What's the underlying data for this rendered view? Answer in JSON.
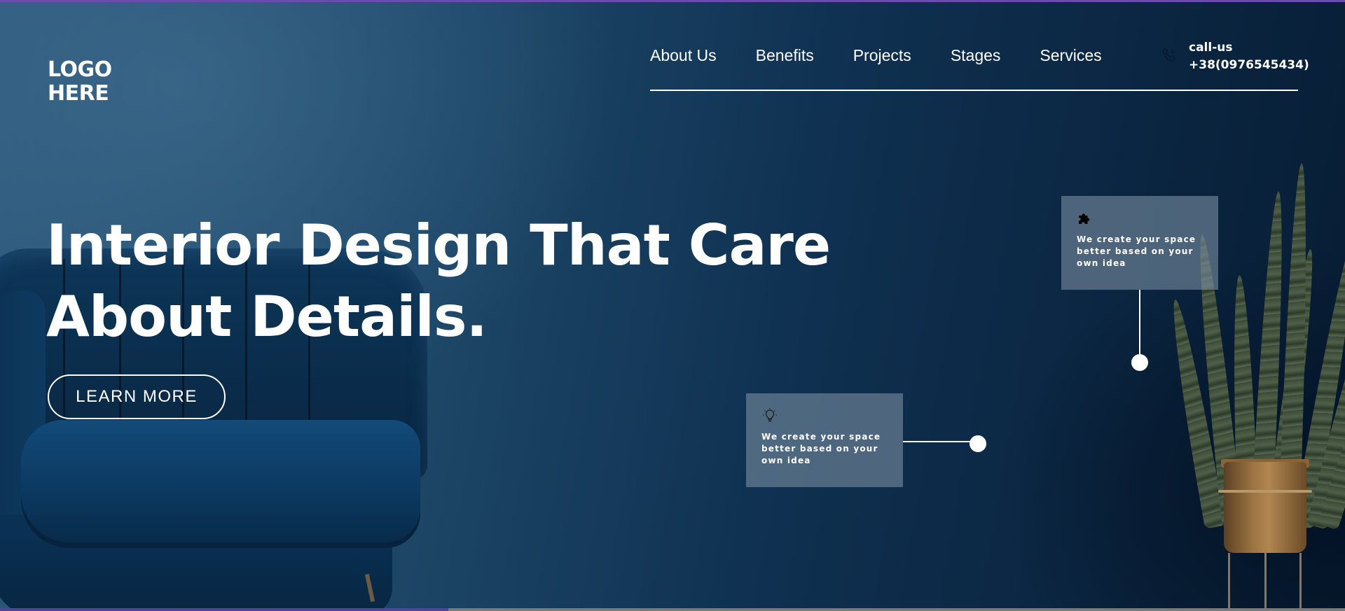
{
  "logo": {
    "line1": "LOGO",
    "line2": "HERE"
  },
  "nav": {
    "items": [
      {
        "label": "About Us"
      },
      {
        "label": "Benefits"
      },
      {
        "label": "Projects"
      },
      {
        "label": "Stages"
      },
      {
        "label": "Services"
      }
    ]
  },
  "contact": {
    "label": "call-us",
    "phone": "+38(0976545434)",
    "icon": "phone-icon"
  },
  "hero": {
    "title_line1": "Interior Design That Care",
    "title_line2": "About Details.",
    "cta_label": "LEARN MORE"
  },
  "cards": [
    {
      "icon": "puzzle-icon",
      "text": "We create your space better based on your own idea"
    },
    {
      "icon": "lightbulb-icon",
      "text": "We create your space better based on your own idea"
    }
  ],
  "colors": {
    "background_dark": "#071c33",
    "background_light": "#2d5a7c",
    "card_bg": "#768a9e",
    "text": "#ffffff",
    "accent_stripe": "#6b4bb0"
  }
}
